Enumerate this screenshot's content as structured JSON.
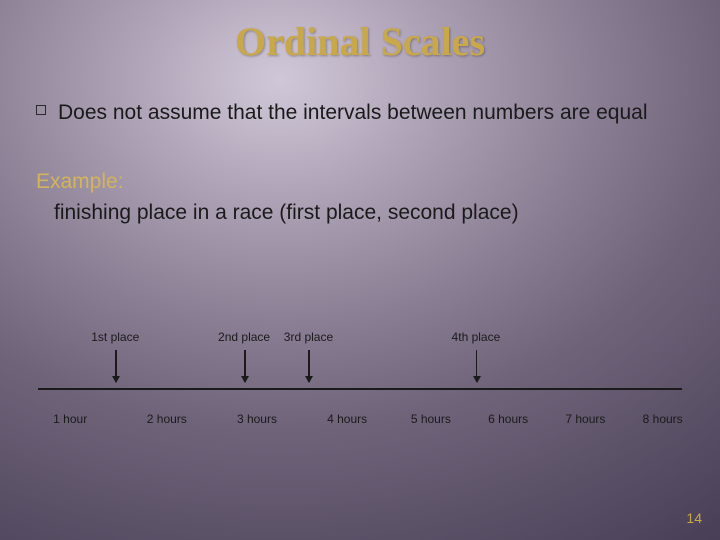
{
  "title": "Ordinal Scales",
  "bullet": "Does not assume that the intervals between numbers are equal",
  "example": {
    "label": "Example:",
    "body": "finishing place in a race (first place, second place)"
  },
  "diagram": {
    "places": [
      {
        "label": "1st place",
        "pct": 12
      },
      {
        "label": "2nd place",
        "pct": 32
      },
      {
        "label": "3rd place",
        "pct": 42
      },
      {
        "label": "4th place",
        "pct": 68
      }
    ],
    "hours": [
      {
        "label": "1 hour",
        "pct": 5
      },
      {
        "label": "2 hours",
        "pct": 20
      },
      {
        "label": "3 hours",
        "pct": 34
      },
      {
        "label": "4 hours",
        "pct": 48
      },
      {
        "label": "5 hours",
        "pct": 61
      },
      {
        "label": "6 hours",
        "pct": 73
      },
      {
        "label": "7 hours",
        "pct": 85
      },
      {
        "label": "8 hours",
        "pct": 97
      }
    ]
  },
  "page_number": "14"
}
